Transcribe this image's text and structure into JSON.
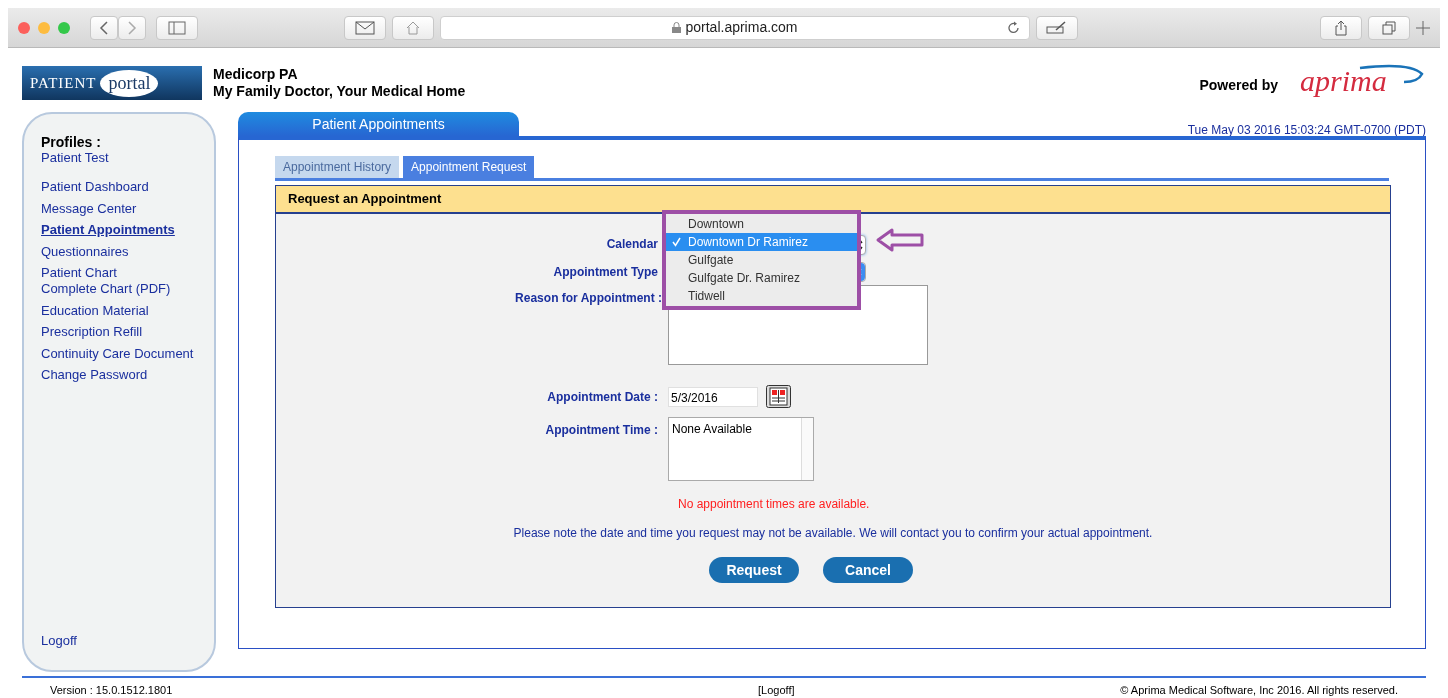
{
  "browser": {
    "url": "portal.aprima.com"
  },
  "header": {
    "logo_word_1": "PATIENT",
    "logo_word_2": "portal",
    "practice": "Medicorp PA",
    "tagline": "My Family Doctor, Your Medical Home",
    "powered_by": "Powered by",
    "brand": "aprima"
  },
  "sidebar": {
    "profiles_label": "Profiles :",
    "profile": "Patient Test",
    "items": [
      {
        "label": "Patient Dashboard",
        "selected": false
      },
      {
        "label": "Message Center",
        "selected": false
      },
      {
        "label": "Patient Appointments",
        "selected": true
      },
      {
        "label": "Questionnaires",
        "selected": false
      },
      {
        "label": "Patient Chart",
        "selected": false
      },
      {
        "label": "Complete Chart (PDF)",
        "selected": false
      },
      {
        "label": "Education Material",
        "selected": false
      },
      {
        "label": "Prescription Refill",
        "selected": false
      },
      {
        "label": "Continuity Care Document",
        "selected": false
      },
      {
        "label": "Change Password",
        "selected": false
      }
    ],
    "logoff": "Logoff"
  },
  "panel": {
    "title": "Patient Appointments",
    "datetime": "Tue May 03 2016 15:03:24 GMT-0700 (PDT)"
  },
  "tabs": [
    {
      "label": "Appointment History",
      "selected": false
    },
    {
      "label": "Appointment Request",
      "selected": true
    }
  ],
  "form": {
    "title": "Request an Appointment",
    "calendar_label": "Calendar",
    "type_label": "Appointment Type",
    "reason_label": "Reason for Appointment :",
    "date_label": "Appointment Date  :",
    "date_value": "5/3/2016",
    "time_label": "Appointment Time  :",
    "time_option": "None Available",
    "error": "No appointment times are available.",
    "note": "Please note the date and time you request may not be available. We will contact you to confirm your actual appointment.",
    "buttons": [
      "Request",
      "Cancel"
    ]
  },
  "calendar_menu": [
    {
      "label": "Downtown",
      "selected": false
    },
    {
      "label": "Downtown Dr Ramirez",
      "selected": true
    },
    {
      "label": "Gulfgate",
      "selected": false
    },
    {
      "label": "Gulfgate Dr. Ramirez",
      "selected": false
    },
    {
      "label": "Tidwell",
      "selected": false
    }
  ],
  "footer": {
    "version": "Version  :  15.0.1512.1801",
    "logoff": "[Logoff]",
    "copyright": "© Aprima Medical Software, Inc 2016. All rights reserved."
  }
}
